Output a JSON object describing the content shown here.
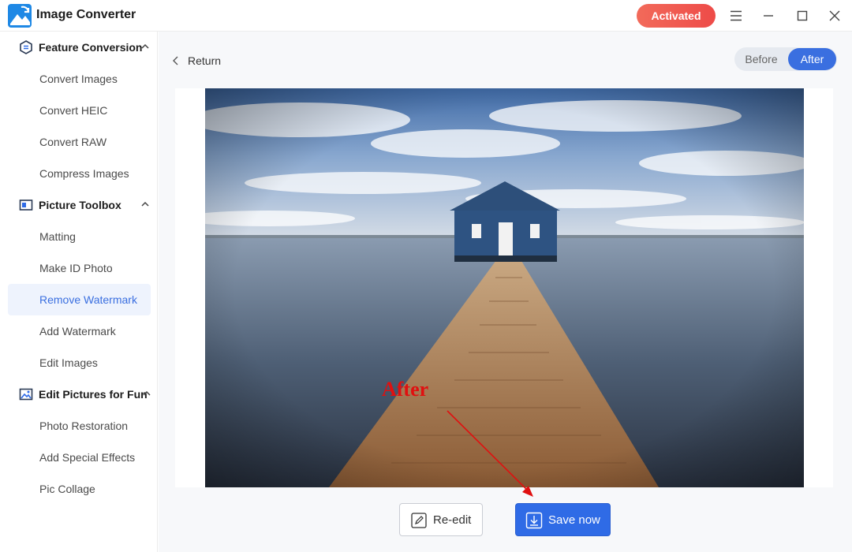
{
  "app": {
    "title": "Image Converter",
    "activated_label": "Activated"
  },
  "window_controls": {
    "menu": "menu-icon",
    "minimize": "minimize-icon",
    "maximize": "maximize-icon",
    "close": "close-icon"
  },
  "sidebar": {
    "groups": [
      {
        "label": "Feature Conversion",
        "icon": "feature-conversion-icon",
        "items": [
          "Convert Images",
          "Convert HEIC",
          "Convert RAW",
          "Compress Images"
        ]
      },
      {
        "label": "Picture Toolbox",
        "icon": "picture-toolbox-icon",
        "items": [
          "Matting",
          "Make ID Photo",
          "Remove Watermark",
          "Add Watermark",
          "Edit Images"
        ]
      },
      {
        "label": "Edit Pictures for Fun",
        "icon": "edit-pictures-icon",
        "items": [
          "Photo Restoration",
          "Add Special Effects",
          "Pic Collage"
        ]
      }
    ],
    "active_item": "Remove Watermark"
  },
  "main": {
    "return_label": "Return",
    "toggle": {
      "before": "Before",
      "after": "After",
      "selected": "After"
    },
    "buttons": {
      "reedit": "Re-edit",
      "save": "Save now"
    },
    "annotation": "After"
  },
  "colors": {
    "accent": "#2f6be6",
    "activated": "#ef5350",
    "annotation": "#e01010"
  }
}
